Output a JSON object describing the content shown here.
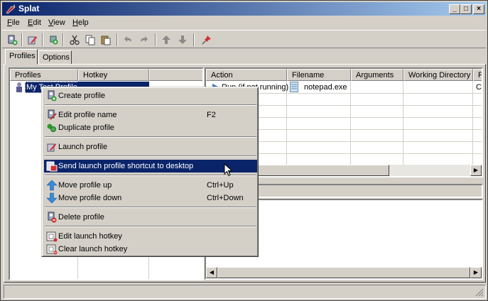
{
  "window": {
    "title": "Splat"
  },
  "menu": [
    {
      "label": "File",
      "accel": "F"
    },
    {
      "label": "Edit",
      "accel": "E"
    },
    {
      "label": "View",
      "accel": "V"
    },
    {
      "label": "Help",
      "accel": "H"
    }
  ],
  "toolbar": {
    "icons": [
      "new-profile-icon",
      "launch-profile-icon",
      "add-action-icon",
      "cut-icon",
      "copy-icon",
      "paste-icon",
      "undo-icon",
      "redo-icon",
      "move-up-icon",
      "move-down-icon",
      "pin-icon"
    ]
  },
  "tabs": [
    {
      "label": "Profiles",
      "active": true
    },
    {
      "label": "Options",
      "active": false
    }
  ],
  "profiles": {
    "columns": [
      "Profiles",
      "Hotkey"
    ],
    "rows": [
      {
        "name": "My Test Profile",
        "hotkey": ""
      }
    ]
  },
  "actions": {
    "columns": [
      "Action",
      "Filename",
      "Arguments",
      "Working Directory",
      "F"
    ],
    "rows": [
      {
        "action": "Run (if not running)",
        "filename": "notepad.exe",
        "arguments": "",
        "working_directory": "",
        "extra": "C"
      }
    ]
  },
  "context_menu": {
    "items": [
      {
        "label": "Create profile",
        "shortcut": "",
        "icon": "create-profile-icon"
      },
      {
        "sep": true
      },
      {
        "label": "Edit profile name",
        "shortcut": "F2",
        "icon": "edit-profile-icon"
      },
      {
        "label": "Duplicate profile",
        "shortcut": "",
        "icon": "duplicate-profile-icon"
      },
      {
        "sep": true
      },
      {
        "label": "Launch profile",
        "shortcut": "",
        "icon": "launch-profile-icon"
      },
      {
        "sep": true
      },
      {
        "label": "Send launch profile shortcut to desktop",
        "shortcut": "",
        "icon": "desktop-shortcut-icon",
        "highlighted": true
      },
      {
        "sep": true
      },
      {
        "label": "Move profile up",
        "shortcut": "Ctrl+Up",
        "icon": "arrow-up-icon"
      },
      {
        "label": "Move profile down",
        "shortcut": "Ctrl+Down",
        "icon": "arrow-down-icon"
      },
      {
        "sep": true
      },
      {
        "label": "Delete profile",
        "shortcut": "",
        "icon": "delete-profile-icon"
      },
      {
        "sep": true
      },
      {
        "label": "Edit launch hotkey",
        "shortcut": "",
        "icon": "edit-hotkey-icon"
      },
      {
        "label": "Clear launch hotkey",
        "shortcut": "",
        "icon": "clear-hotkey-icon"
      }
    ]
  },
  "colors": {
    "titlebar_start": "#0a246a",
    "titlebar_end": "#a6caf0",
    "highlight": "#0a246a",
    "face": "#d4d0c8"
  }
}
